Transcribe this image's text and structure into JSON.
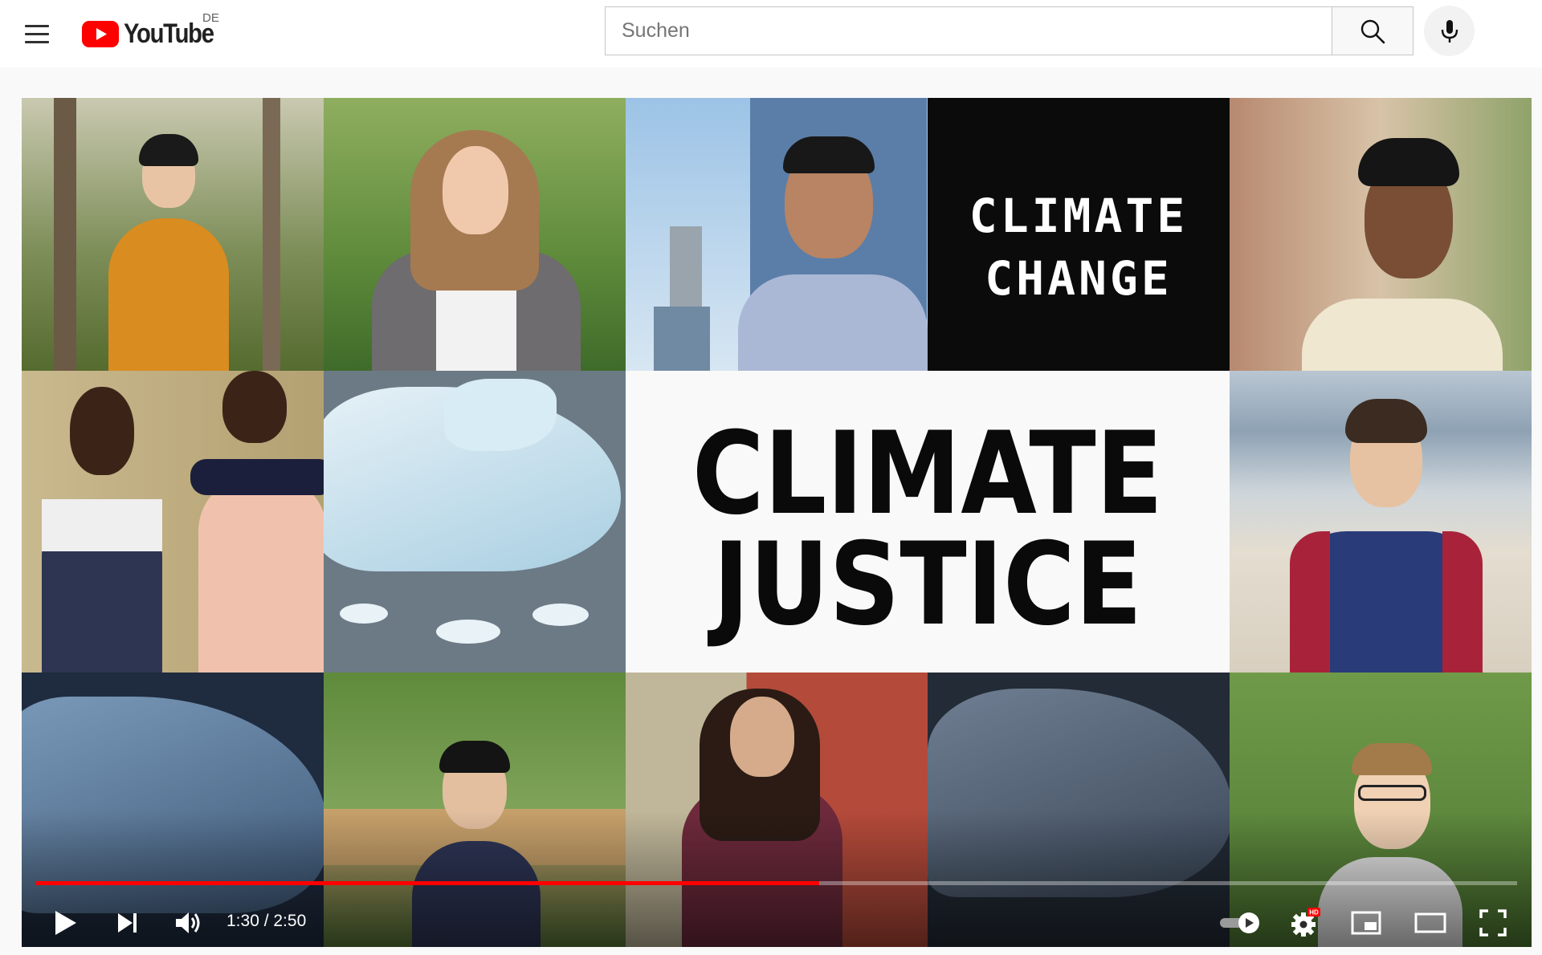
{
  "masthead": {
    "logo_text": "YouTube",
    "region": "DE",
    "search_placeholder": "Suchen"
  },
  "video": {
    "overlay_top": "CLIMATE\nCHANGE",
    "overlay_main_line1": "CLIMATE",
    "overlay_main_line2": "JUSTICE"
  },
  "player": {
    "current_time": "1:30",
    "duration": "2:50",
    "time_display": "1:30 / 2:50",
    "progress_fraction": 0.529,
    "quality_badge": "HD",
    "progress_color": "#ff0000"
  },
  "colors": {
    "brand_red": "#ff0000"
  }
}
